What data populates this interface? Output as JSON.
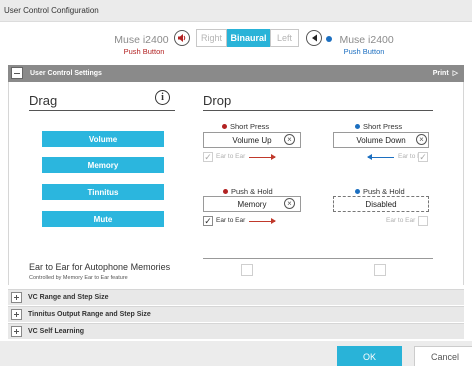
{
  "window": {
    "title": "User Control Configuration"
  },
  "device": {
    "left": {
      "name": "Muse i2400",
      "subtitle": "Push Button",
      "color": "#b22222"
    },
    "right": {
      "name": "Muse i2400",
      "subtitle": "Push Button",
      "color": "#1c6fc0"
    },
    "modes": [
      "Right",
      "Binaural",
      "Left"
    ],
    "selected_mode": "Binaural"
  },
  "section": {
    "title": "User Control Settings",
    "print_label": "Print"
  },
  "drag": {
    "heading": "Drag",
    "buttons": [
      "Volume",
      "Memory",
      "Tinnitus",
      "Mute"
    ]
  },
  "drop": {
    "heading": "Drop",
    "short_press": {
      "label": "Short Press",
      "left_value": "Volume Up",
      "right_value": "Volume Down",
      "ear_to_ear_label": "Ear to Ear",
      "left_checked": true,
      "right_checked": true
    },
    "push_hold": {
      "label": "Push & Hold",
      "left_value": "Memory",
      "right_value": "Disabled",
      "ear_to_ear_label": "Ear to Ear",
      "left_checked": true,
      "right_checked": false
    }
  },
  "autophone": {
    "label": "Ear to Ear for Autophone Memories",
    "note": "Controlled by Memory Ear to Ear feature"
  },
  "subsections": [
    "VC Range and Step Size",
    "Tinnitus Output Range and Step Size",
    "VC Self Learning"
  ],
  "footer": {
    "ok_label": "OK",
    "cancel_label": "Cancel"
  },
  "colors": {
    "accent": "#29b3d8",
    "left_ear": "#b22222",
    "right_ear": "#1c6fc0"
  }
}
